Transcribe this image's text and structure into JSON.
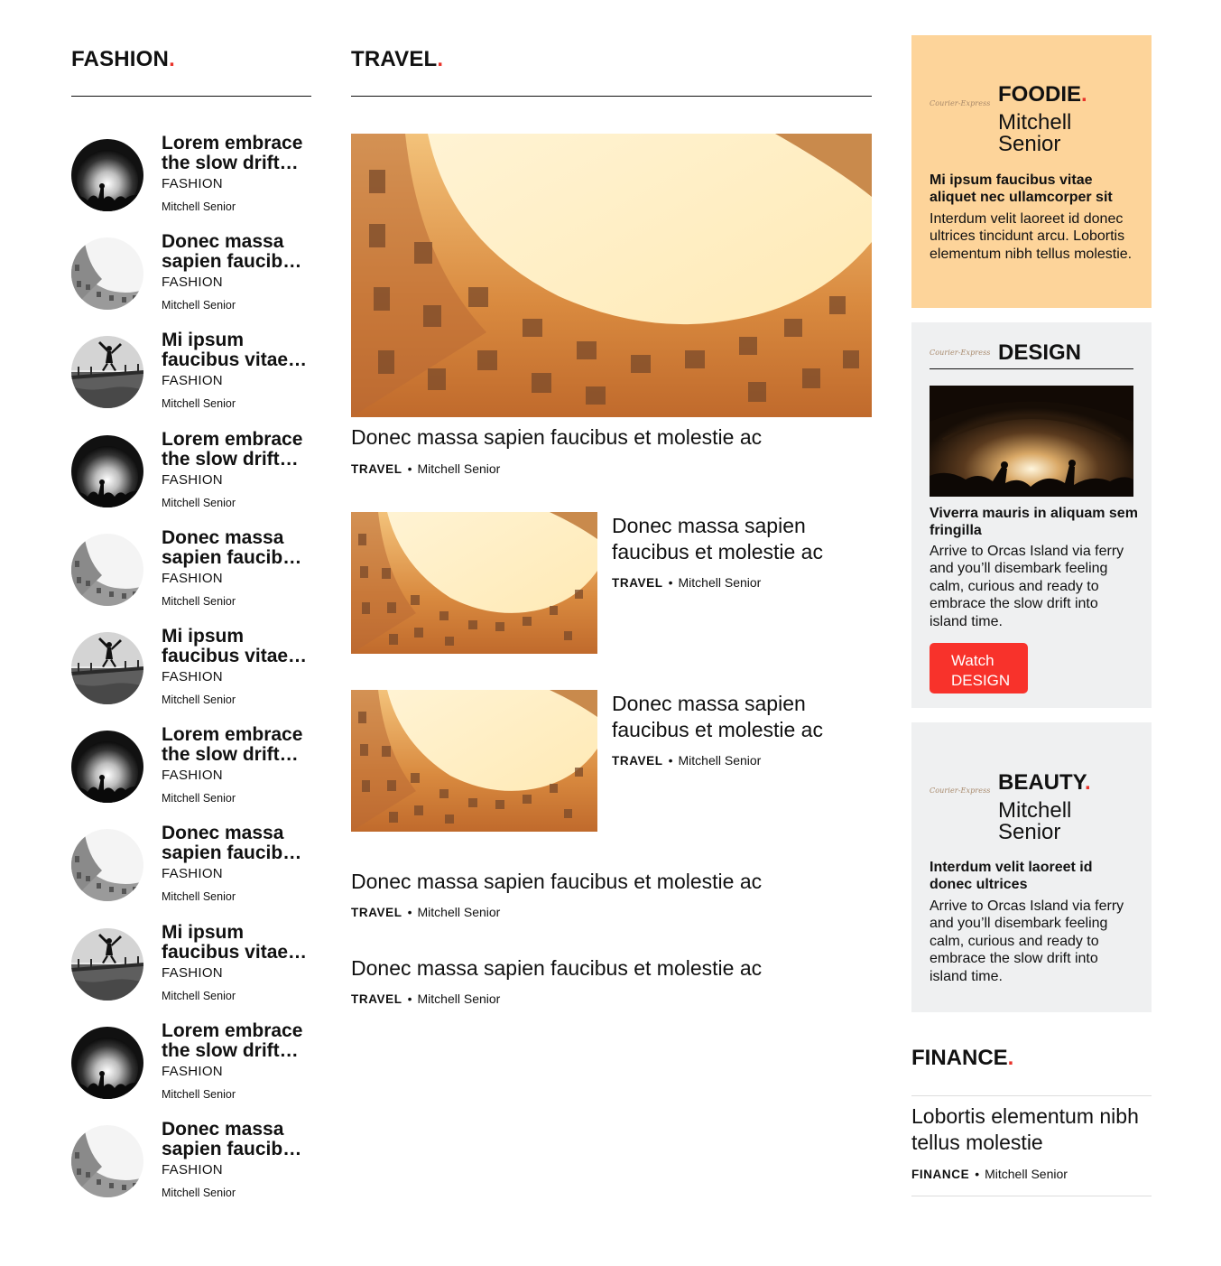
{
  "fashion": {
    "title": "FASHION",
    "dot": ".",
    "items": [
      {
        "title": "Lorem embrace the slow drift…",
        "category": "FASHION",
        "author": "Mitchell Senior",
        "image": "crowd-concert-bw"
      },
      {
        "title": "Donec massa sapien faucib…",
        "category": "FASHION",
        "author": "Mitchell Senior",
        "image": "building-bw"
      },
      {
        "title": "Mi ipsum faucibus vitae…",
        "category": "FASHION",
        "author": "Mitchell Senior",
        "image": "jumping-person-bw"
      },
      {
        "title": "Lorem embrace the slow drift…",
        "category": "FASHION",
        "author": "Mitchell Senior",
        "image": "crowd-concert-bw"
      },
      {
        "title": "Donec massa sapien faucib…",
        "category": "FASHION",
        "author": "Mitchell Senior",
        "image": "building-bw"
      },
      {
        "title": "Mi ipsum faucibus vitae…",
        "category": "FASHION",
        "author": "Mitchell Senior",
        "image": "jumping-person-bw"
      },
      {
        "title": "Lorem embrace the slow drift…",
        "category": "FASHION",
        "author": "Mitchell Senior",
        "image": "crowd-concert-bw"
      },
      {
        "title": "Donec massa sapien faucib…",
        "category": "FASHION",
        "author": "Mitchell Senior",
        "image": "building-bw"
      },
      {
        "title": "Mi ipsum faucibus vitae…",
        "category": "FASHION",
        "author": "Mitchell Senior",
        "image": "jumping-person-bw"
      },
      {
        "title": "Lorem embrace the slow drift…",
        "category": "FASHION",
        "author": "Mitchell Senior",
        "image": "crowd-concert-bw"
      },
      {
        "title": "Donec massa sapien faucib…",
        "category": "FASHION",
        "author": "Mitchell Senior",
        "image": "building-bw"
      }
    ]
  },
  "travel": {
    "title": "TRAVEL",
    "dot": ".",
    "separator": "•",
    "hero": {
      "title": "Donec massa sapien faucibus et molestie ac",
      "category": "TRAVEL",
      "author": "Mitchell Senior",
      "image": "courtyard-building-warm"
    },
    "side_items": [
      {
        "title": "Donec massa sapien faucibus et molestie ac",
        "category": "TRAVEL",
        "author": "Mitchell Senior",
        "image": "courtyard-building-warm"
      },
      {
        "title": "Donec massa sapien faucibus et molestie ac",
        "category": "TRAVEL",
        "author": "Mitchell Senior",
        "image": "courtyard-building-warm"
      }
    ],
    "text_items": [
      {
        "title": "Donec massa sapien faucibus et molestie ac",
        "category": "TRAVEL",
        "author": "Mitchell Senior"
      },
      {
        "title": "Donec massa sapien faucibus et molestie ac",
        "category": "TRAVEL",
        "author": "Mitchell Senior"
      }
    ]
  },
  "sidebar": {
    "brand_logo": "Courier-Express",
    "foodie": {
      "heading": "FOODIE",
      "dot": ".",
      "author": "Mitchell Senior",
      "subtitle": "Mi ipsum faucibus vitae aliquet nec ullamcorper sit",
      "body": "Interdum velit laoreet id donec ultrices tincidunt arcu. Lobortis elementum nibh tellus molestie.",
      "background": "#fdd49a"
    },
    "design": {
      "heading": "DESIGN",
      "subtitle": "Viverra mauris in aliquam sem fringilla",
      "body": "Arrive to Orcas Island via ferry and you’ll disembark feeling calm, curious and ready to embrace the slow drift into island time.",
      "button_label": "Watch DESIGN",
      "button_color": "#f8322b",
      "image": "concert-stage-dark",
      "background": "#eff0f1"
    },
    "beauty": {
      "heading": "BEAUTY",
      "dot": ".",
      "author": "Mitchell Senior",
      "subtitle": "Interdum velit laoreet id donec ultrices",
      "body": "Arrive to Orcas Island via ferry and you’ll disembark feeling calm, curious and ready to embrace the slow drift into island time.",
      "background": "#eff0f1"
    },
    "finance": {
      "title": "FINANCE",
      "dot": ".",
      "headline": "Lobortis elementum nibh tellus molestie",
      "category": "FINANCE",
      "separator": "•",
      "author": "Mitchell Senior"
    }
  },
  "accent_color": "#e8332a"
}
